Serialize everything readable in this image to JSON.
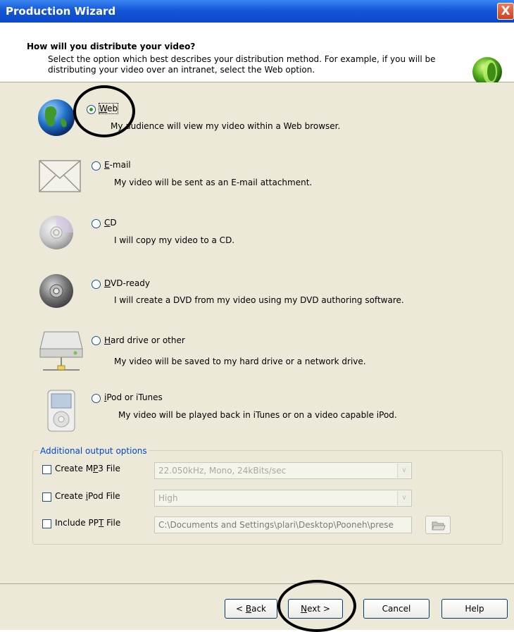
{
  "window": {
    "title": "Production Wizard",
    "close_glyph": "X"
  },
  "header": {
    "title": "How will you distribute your video?",
    "description_line1": "Select the option which best describes your distribution method.  For example, if you will be",
    "description_line2": "distributing your video over an intranet, select the Web option."
  },
  "options": [
    {
      "label_pre": "",
      "label_mnemonic": "W",
      "label_post": "eb",
      "desc": "My audience will view my video within a Web browser.",
      "checked": true,
      "icon": "globe-icon"
    },
    {
      "label_pre": "",
      "label_mnemonic": "E",
      "label_post": "-mail",
      "desc": "My video will be sent as an E-mail attachment.",
      "checked": false,
      "icon": "envelope-icon"
    },
    {
      "label_pre": "",
      "label_mnemonic": "C",
      "label_post": "D",
      "desc": "I will copy my video to a CD.",
      "checked": false,
      "icon": "cd-icon"
    },
    {
      "label_pre": "",
      "label_mnemonic": "D",
      "label_post": "VD-ready",
      "desc": "I will create a DVD from my video using my DVD authoring software.",
      "checked": false,
      "icon": "dvd-icon"
    },
    {
      "label_pre": "",
      "label_mnemonic": "H",
      "label_post": "ard drive or other",
      "desc": "My video will be saved to my hard drive or a network drive.",
      "checked": false,
      "icon": "hard-drive-icon"
    },
    {
      "label_pre": "",
      "label_mnemonic": "i",
      "label_post": "Pod or iTunes",
      "desc": "My video will be played back in iTunes or on a video capable iPod.",
      "checked": false,
      "icon": "ipod-icon"
    }
  ],
  "additional": {
    "group_label": "Additional output options",
    "mp3": {
      "label_pre": "Create M",
      "label_mnemonic": "P",
      "label_post": "3 File",
      "value": "22.050kHz, Mono, 24kBits/sec",
      "checked": false
    },
    "ipod": {
      "label_pre": "Create ",
      "label_mnemonic": "i",
      "label_post": "Pod File",
      "value": "High",
      "checked": false
    },
    "ppt": {
      "label_pre": "Include PP",
      "label_mnemonic": "T",
      "label_post": " File",
      "value": "C:\\Documents and Settings\\plari\\Desktop\\Pooneh\\prese",
      "checked": false
    }
  },
  "buttons": {
    "back": {
      "pre": "< ",
      "mnemonic": "B",
      "post": "ack"
    },
    "next": {
      "pre": "",
      "mnemonic": "N",
      "post": "ext >"
    },
    "cancel": "Cancel",
    "help": "Help"
  },
  "colors": {
    "titlebar": "#0a48c8",
    "panel": "#ece9d8",
    "group_label": "#0046d5",
    "radio_dot": "#21a121",
    "annotation": "#000000"
  }
}
